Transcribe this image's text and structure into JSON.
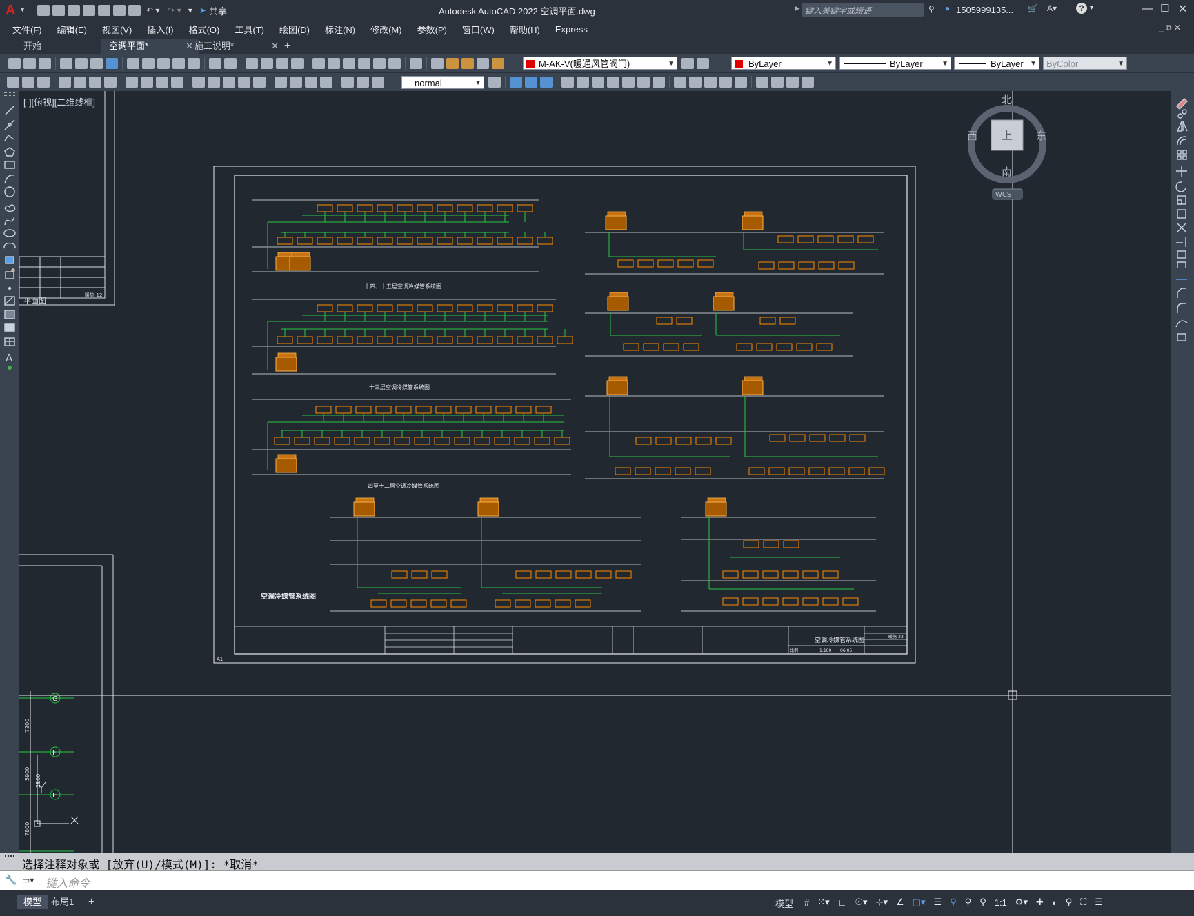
{
  "app": {
    "title": "Autodesk AutoCAD 2022    空调平面.dwg",
    "logo_letter": "A",
    "share_label": "共享",
    "search_placeholder": "键入关键字或短语",
    "user": "1505999135...",
    "help": "?"
  },
  "menu": [
    "文件(F)",
    "编辑(E)",
    "视图(V)",
    "插入(I)",
    "格式(O)",
    "工具(T)",
    "绘图(D)",
    "标注(N)",
    "修改(M)",
    "参数(P)",
    "窗口(W)",
    "帮助(H)",
    "Express"
  ],
  "tabs": [
    {
      "label": "开始",
      "active": false
    },
    {
      "label": "空调平面*",
      "active": true
    },
    {
      "label": "施工说明*",
      "active": false
    }
  ],
  "toolbar": {
    "layer_name": "M-AK-V(暖通风管阀门)",
    "layer_color": "#e00000",
    "color_combo": "ByLayer",
    "linetype_combo": "ByLayer",
    "lineweight_combo": "ByLayer",
    "plotstyle_combo": "ByColor",
    "text_style": "normal"
  },
  "viewport": {
    "label": "[-][俯视][二维线框]",
    "compass": {
      "north": "北",
      "south": "南",
      "east": "东",
      "west": "西",
      "top": "上",
      "wcs": "WCS"
    }
  },
  "drawing": {
    "sheet_size": "A1",
    "main_title": "空调冷媒管系统图",
    "section_titles": [
      "十四、十五层空调冷媒管系统图",
      "十三层空调冷媒管系统图",
      "四至十二层空调冷媒管系统图"
    ],
    "title_block": {
      "drawing_name": "空调冷媒管系统图",
      "scale_label": "比例",
      "scale": "1:100",
      "date": "06.05",
      "sheet_no": "暖施-23"
    },
    "left_sheet_label": "平面图",
    "left_sheet_sheetno": "暖施-12",
    "axis_labels": [
      "G",
      "F",
      "E"
    ],
    "dims": [
      "7200",
      "5900",
      "2100",
      "7800"
    ]
  },
  "command": {
    "history": "选择注释对象或 [放弃(U)/模式(M)]: *取消*",
    "input_placeholder": "键入命令"
  },
  "status": {
    "layout_tabs": [
      {
        "label": "模型",
        "active": true
      },
      {
        "label": "布局1",
        "active": false
      }
    ],
    "model_label": "模型",
    "scale": "1:1"
  }
}
